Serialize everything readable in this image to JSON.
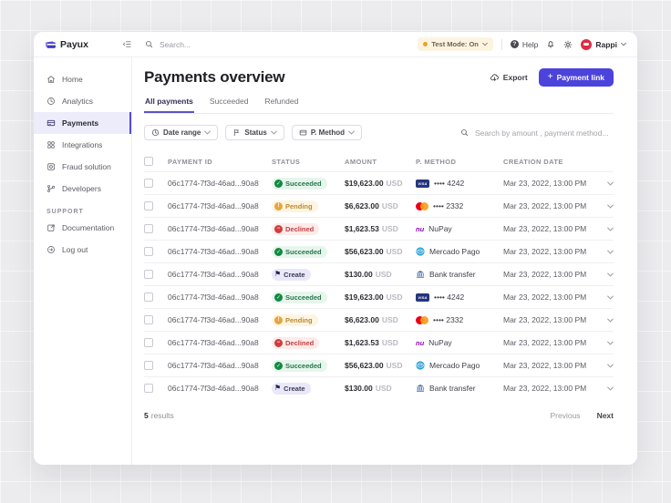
{
  "brand": {
    "name": "Payux",
    "accent_color": "#4b43db"
  },
  "topbar": {
    "search_placeholder": "Search...",
    "test_mode_label": "Test Mode: On",
    "test_mode_dot_color": "#efa229",
    "help_label": "Help",
    "user_name": "Rappi",
    "avatar_color": "#e02c44"
  },
  "sidebar": {
    "items": [
      {
        "label": "Home",
        "icon": "home-icon",
        "active": false
      },
      {
        "label": "Analytics",
        "icon": "analytics-icon",
        "active": false
      },
      {
        "label": "Payments",
        "icon": "payments-icon",
        "active": true
      },
      {
        "label": "Integrations",
        "icon": "integrations-icon",
        "active": false
      },
      {
        "label": "Fraud solution",
        "icon": "fraud-solution-icon",
        "active": false
      },
      {
        "label": "Developers",
        "icon": "developers-icon",
        "active": false
      }
    ],
    "section_label": "SUPPORT",
    "support_items": [
      {
        "label": "Documentation",
        "icon": "documentation-icon"
      },
      {
        "label": "Log out",
        "icon": "logout-icon"
      }
    ]
  },
  "main": {
    "title": "Payments overview",
    "export_label": "Export",
    "payment_link_label": "Payment link",
    "tabs": [
      {
        "label": "All payments",
        "active": true
      },
      {
        "label": "Succeeded",
        "active": false
      },
      {
        "label": "Refunded",
        "active": false
      }
    ],
    "filters": [
      {
        "label": "Date range",
        "icon": "clock-icon"
      },
      {
        "label": "Status",
        "icon": "flag-icon"
      },
      {
        "label": "P. Method",
        "icon": "card-icon"
      }
    ],
    "table_search_placeholder": "Search by amount , payment method...",
    "table": {
      "headers": [
        "PAYMENT ID",
        "STATUS",
        "AMOUNT",
        "P. METHOD",
        "CREATION DATE"
      ],
      "status_colors": {
        "succeeded": "#108a43",
        "pending": "#e8a63c",
        "declined": "#cf3d3d",
        "create": "#23224f"
      },
      "rows": [
        {
          "payment_id": "06c1774-7f3d-46ad...90a8",
          "status": "Succeeded",
          "status_type": "succeeded",
          "amount": "$19,623.00",
          "currency": "USD",
          "method_label": "•••• 4242",
          "method_type": "visa",
          "date": "Mar 23, 2022, 13:00 PM"
        },
        {
          "payment_id": "06c1774-7f3d-46ad...90a8",
          "status": "Pending",
          "status_type": "pending",
          "amount": "$6,623.00",
          "currency": "USD",
          "method_label": "•••• 2332",
          "method_type": "mastercard",
          "date": "Mar 23, 2022, 13:00 PM"
        },
        {
          "payment_id": "06c1774-7f3d-46ad...90a8",
          "status": "Declined",
          "status_type": "declined",
          "amount": "$1,623.53",
          "currency": "USD",
          "method_label": "NuPay",
          "method_type": "nupay",
          "date": "Mar 23, 2022, 13:00 PM"
        },
        {
          "payment_id": "06c1774-7f3d-46ad...90a8",
          "status": "Succeeded",
          "status_type": "succeeded",
          "amount": "$56,623.00",
          "currency": "USD",
          "method_label": "Mercado Pago",
          "method_type": "mercadopago",
          "date": "Mar 23, 2022, 13:00 PM"
        },
        {
          "payment_id": "06c1774-7f3d-46ad...90a8",
          "status": "Create",
          "status_type": "create",
          "amount": "$130.00",
          "currency": "USD",
          "method_label": "Bank transfer",
          "method_type": "bank",
          "date": "Mar 23, 2022, 13:00 PM"
        },
        {
          "payment_id": "06c1774-7f3d-46ad...90a8",
          "status": "Succeeded",
          "status_type": "succeeded",
          "amount": "$19,623.00",
          "currency": "USD",
          "method_label": "•••• 4242",
          "method_type": "visa",
          "date": "Mar 23, 2022, 13:00 PM"
        },
        {
          "payment_id": "06c1774-7f3d-46ad...90a8",
          "status": "Pending",
          "status_type": "pending",
          "amount": "$6,623.00",
          "currency": "USD",
          "method_label": "•••• 2332",
          "method_type": "mastercard",
          "date": "Mar 23, 2022, 13:00 PM"
        },
        {
          "payment_id": "06c1774-7f3d-46ad...90a8",
          "status": "Declined",
          "status_type": "declined",
          "amount": "$1,623.53",
          "currency": "USD",
          "method_label": "NuPay",
          "method_type": "nupay",
          "date": "Mar 23, 2022, 13:00 PM"
        },
        {
          "payment_id": "06c1774-7f3d-46ad...90a8",
          "status": "Succeeded",
          "status_type": "succeeded",
          "amount": "$56,623.00",
          "currency": "USD",
          "method_label": "Mercado Pago",
          "method_type": "mercadopago",
          "date": "Mar 23, 2022, 13:00 PM"
        },
        {
          "payment_id": "06c1774-7f3d-46ad...90a8",
          "status": "Create",
          "status_type": "create",
          "amount": "$130.00",
          "currency": "USD",
          "method_label": "Bank transfer",
          "method_type": "bank",
          "date": "Mar 23, 2022, 13:00 PM"
        }
      ]
    },
    "footer": {
      "results_count": "5",
      "results_label": "results",
      "previous_label": "Previous",
      "next_label": "Next"
    }
  }
}
